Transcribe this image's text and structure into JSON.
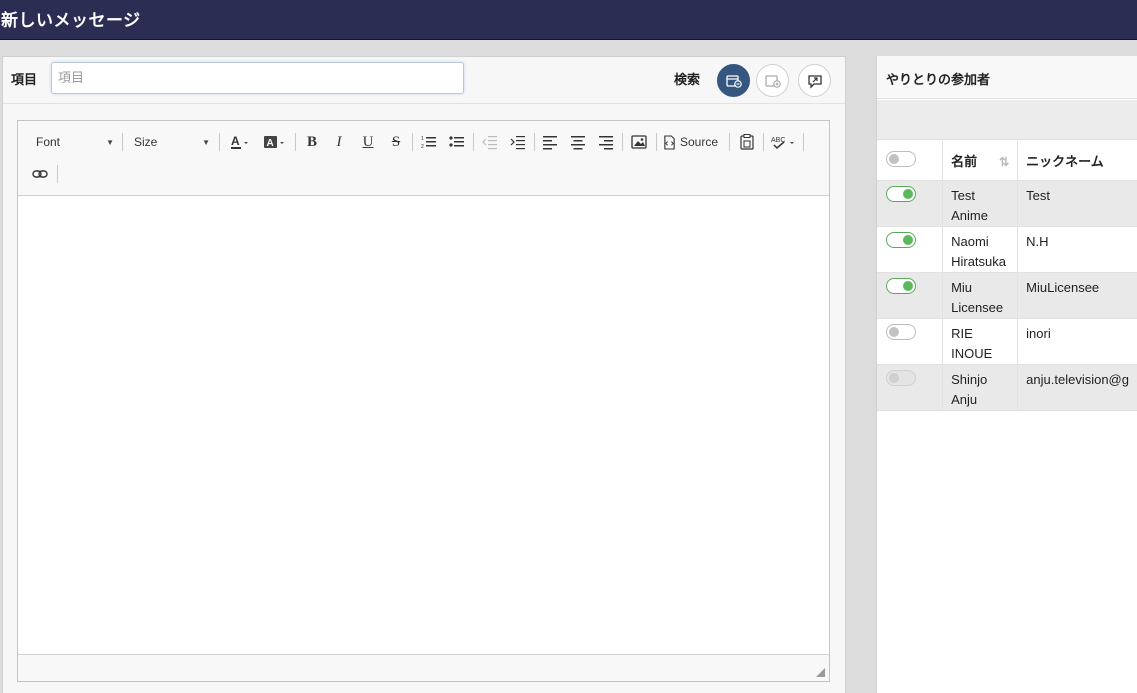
{
  "header": {
    "title": "新しいメッセージ"
  },
  "subject": {
    "label": "項目",
    "placeholder": "項目",
    "value": ""
  },
  "search": {
    "label": "検索"
  },
  "toolbar": {
    "font_combo": "Font",
    "size_combo": "Size",
    "source_label": "Source",
    "buttons": [
      "text-color",
      "background-color",
      "bold",
      "italic",
      "underline",
      "strikethrough",
      "numbered-list",
      "bulleted-list",
      "decrease-indent",
      "increase-indent",
      "align-left",
      "align-center",
      "align-right",
      "image",
      "source",
      "paste-from-word",
      "spell-check",
      "link"
    ]
  },
  "participants": {
    "title": "やりとりの参加者",
    "columns": {
      "name": "名前",
      "nickname": "ニックネーム"
    },
    "header_toggle": "off",
    "rows": [
      {
        "name": "Test\nAnime",
        "nickname": "Test",
        "toggle": "on"
      },
      {
        "name": "Naomi\nHiratsuka",
        "nickname": "N.H",
        "toggle": "on"
      },
      {
        "name": "Miu\nLicensee",
        "nickname": "MiuLicensee",
        "toggle": "on"
      },
      {
        "name": "RIE\nINOUE",
        "nickname": "inori",
        "toggle": "off"
      },
      {
        "name": "Shinjo\nAnju",
        "nickname": "anju.television@g",
        "toggle": "disabled"
      }
    ]
  },
  "colors": {
    "topbar": "#2b2d52",
    "accent": "#35577f",
    "toggle_on": "#5cb85c"
  }
}
